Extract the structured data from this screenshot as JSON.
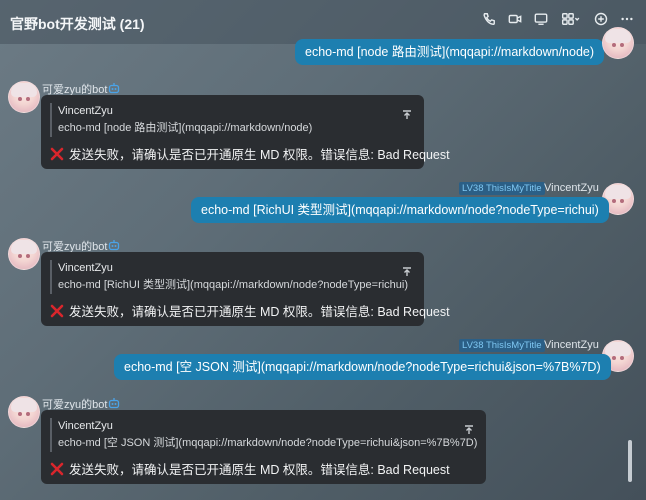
{
  "header": {
    "title": "官野bot开发测试 (21)",
    "icons": [
      "phone-icon",
      "video-icon",
      "screen-share-icon",
      "apps-icon",
      "add-icon",
      "more-icon"
    ]
  },
  "messages": {
    "m1": {
      "text": "echo-md [node 路由测试](mqqapi://markdown/node)"
    },
    "m2": {
      "sender": "可爱zyu的bot",
      "quote_name": "VincentZyu",
      "quote_text": "echo-md [node 路由测试](mqqapi://markdown/node)",
      "error": "发送失败，请确认是否已开通原生 MD 权限。错误信息: Bad Request"
    },
    "m3": {
      "level": "LV38 ThisIsMyTitle",
      "sender": "VincentZyu",
      "text": "echo-md [RichUI 类型测试](mqqapi://markdown/node?nodeType=richui)"
    },
    "m4": {
      "sender": "可爱zyu的bot",
      "quote_name": "VincentZyu",
      "quote_text": "echo-md [RichUI 类型测试](mqqapi://markdown/node?nodeType=richui)",
      "error": "发送失败，请确认是否已开通原生 MD 权限。错误信息: Bad Request"
    },
    "m5": {
      "level": "LV38 ThisIsMyTitle",
      "sender": "VincentZyu",
      "text": "echo-md [空 JSON 测试](mqqapi://markdown/node?nodeType=richui&json=%7B%7D)"
    },
    "m6": {
      "sender": "可爱zyu的bot",
      "quote_name": "VincentZyu",
      "quote_text": "echo-md [空 JSON 测试](mqqapi://markdown/node?nodeType=richui&json=%7B%7D)",
      "error": "发送失败，请确认是否已开通原生 MD 权限。错误信息: Bad Request"
    }
  },
  "colors": {
    "accent": "#1d7fb0",
    "card": "#2a2d31",
    "error": "#d9262c",
    "bot_icon": "#4aa3e8"
  }
}
